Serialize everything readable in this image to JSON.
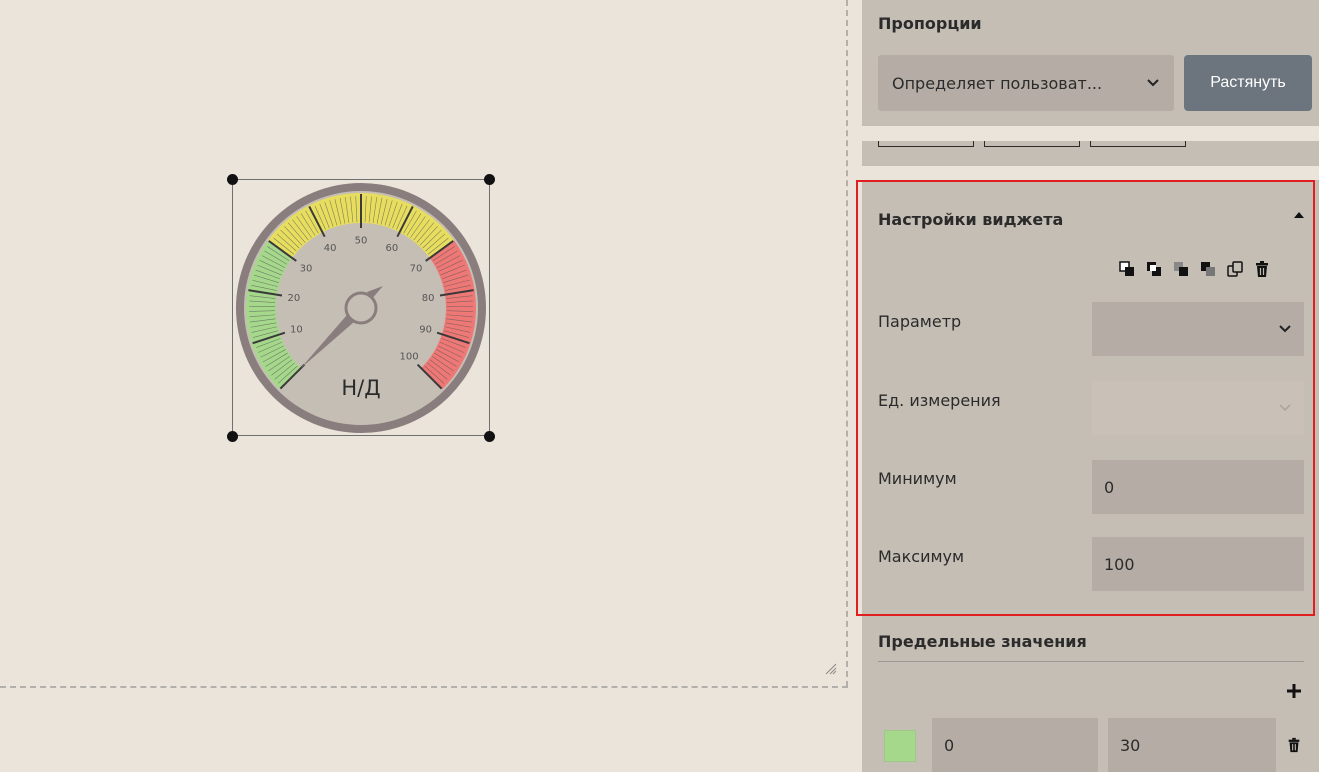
{
  "gauge": {
    "ticks": [
      "10",
      "20",
      "30",
      "40",
      "50",
      "60",
      "70",
      "80",
      "90",
      "100"
    ],
    "value_text": "Н/Д",
    "value": null,
    "min": 0,
    "max": 100,
    "colors": {
      "green": "#a6d88c",
      "yellow": "#e7dd5f",
      "red": "#ee7876",
      "rim": "#8a7d7e",
      "face": "#c5beb5"
    }
  },
  "proportions": {
    "title": "Пропорции",
    "select_value": "Определяет пользоват...",
    "stretch_label": "Растянуть"
  },
  "widget_settings": {
    "title": "Настройки виджета",
    "toolbar_icons": [
      "bring-forward-icon",
      "bring-to-front-icon",
      "send-backward-icon",
      "send-to-back-icon",
      "copy-icon",
      "trash-icon"
    ],
    "fields": {
      "parameter": {
        "label": "Параметр",
        "value": ""
      },
      "unit": {
        "label": "Ед. измерения",
        "value": ""
      },
      "minimum": {
        "label": "Минимум",
        "value": "0"
      },
      "maximum": {
        "label": "Максимум",
        "value": "100"
      }
    }
  },
  "limits": {
    "title": "Предельные значения",
    "rows": [
      {
        "color": "#a6d88c",
        "from": "0",
        "to": "30"
      }
    ]
  }
}
